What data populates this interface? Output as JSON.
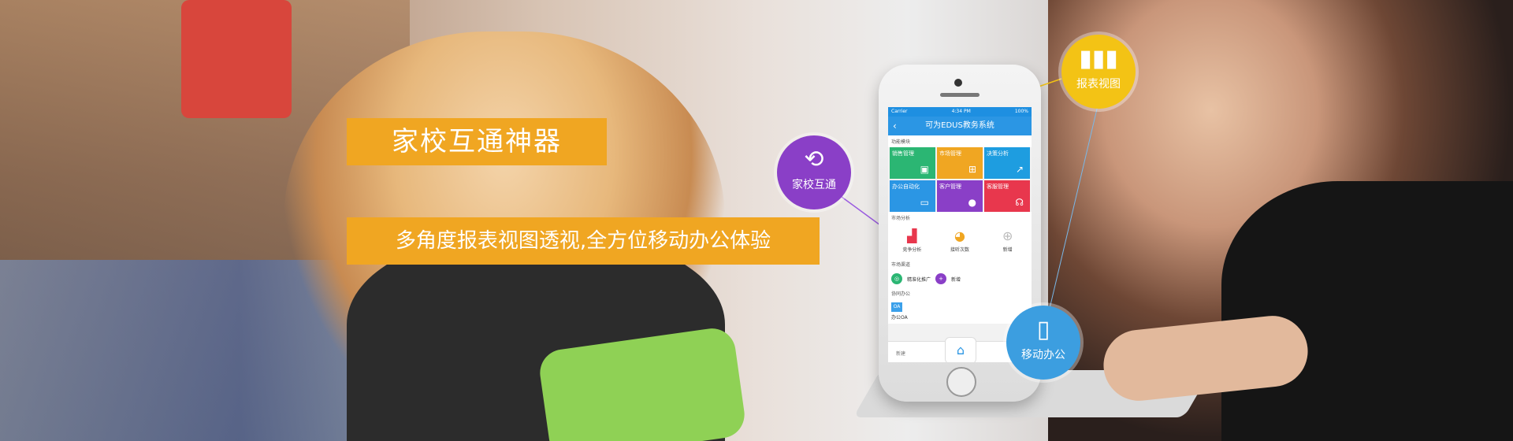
{
  "headline": "家校互通神器",
  "subheadline": "多角度报表视图透视,全方位移动办公体验",
  "colors": {
    "accent": "#f0a622",
    "purple": "#8a3fc7",
    "yellow": "#f3c315",
    "blue": "#3c9ee0",
    "app_blue": "#2b96e4"
  },
  "badges": {
    "home_school": {
      "label": "家校互通",
      "icon": "people-exchange-icon"
    },
    "report_view": {
      "label": "报表视图",
      "icon": "bar-chart-icon"
    },
    "mobile_office": {
      "label": "移动办公",
      "icon": "phone-globe-icon"
    }
  },
  "phone": {
    "status_left": "Carrier",
    "status_time": "4:34 PM",
    "status_right": "100%",
    "app_title": "可为EDUS教务系统",
    "section_functions": "功能模块",
    "tiles": [
      {
        "label": "销售管理",
        "color": "#2bb673",
        "icon": "briefcase-icon"
      },
      {
        "label": "市场管理",
        "color": "#f0a622",
        "icon": "basket-icon"
      },
      {
        "label": "决策分析",
        "color": "#1e9de0",
        "icon": "trend-icon"
      },
      {
        "label": "办公自动化",
        "color": "#2b96e4",
        "icon": "monitor-icon"
      },
      {
        "label": "客户管理",
        "color": "#8a3fc7",
        "icon": "user-icon"
      },
      {
        "label": "客服管理",
        "color": "#e8374d",
        "icon": "headset-icon"
      }
    ],
    "section_market": "市场分析",
    "analysis": [
      {
        "label": "竞争分析",
        "icon": "chart-icon"
      },
      {
        "label": "接听次数",
        "icon": "pie-icon"
      },
      {
        "label": "新增",
        "icon": "plus-icon"
      }
    ],
    "section_channel": "市场渠道",
    "channel_items": [
      "精准化推广",
      "新增"
    ],
    "section_office": "协同办公",
    "office_item": "办公OA",
    "tab_left": "新建"
  }
}
